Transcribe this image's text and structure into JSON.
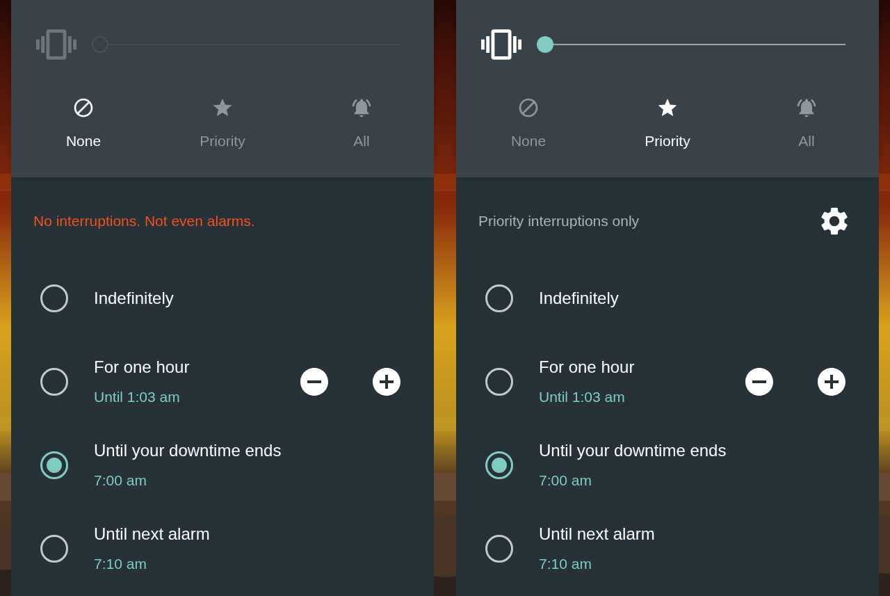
{
  "panels": [
    {
      "vibrate_slider": {
        "enabled": false,
        "level": 0
      },
      "modes": [
        {
          "label": "None",
          "kind": "none",
          "selected": true
        },
        {
          "label": "Priority",
          "kind": "priority",
          "selected": false
        },
        {
          "label": "All",
          "kind": "all",
          "selected": false
        }
      ],
      "status": {
        "text": "No interruptions. Not even alarms.",
        "kind": "warning"
      },
      "options": [
        {
          "title": "Indefinitely",
          "kind": "plain",
          "selected": false
        },
        {
          "title": "For one hour",
          "subtitle": "Until 1:03 am",
          "kind": "stepper",
          "selected": false
        },
        {
          "title": "Until your downtime ends",
          "subtitle": "7:00 am",
          "kind": "plain",
          "selected": true
        },
        {
          "title": "Until next alarm",
          "subtitle": "7:10 am",
          "kind": "plain",
          "selected": false
        }
      ]
    },
    {
      "vibrate_slider": {
        "enabled": true,
        "level": 0
      },
      "modes": [
        {
          "label": "None",
          "kind": "none",
          "selected": false
        },
        {
          "label": "Priority",
          "kind": "priority",
          "selected": true
        },
        {
          "label": "All",
          "kind": "all",
          "selected": false
        }
      ],
      "status": {
        "text": "Priority interruptions only",
        "kind": "info",
        "settings": true
      },
      "options": [
        {
          "title": "Indefinitely",
          "kind": "plain",
          "selected": false
        },
        {
          "title": "For one hour",
          "subtitle": "Until 1:03 am",
          "kind": "stepper",
          "selected": false
        },
        {
          "title": "Until your downtime ends",
          "subtitle": "7:00 am",
          "kind": "plain",
          "selected": true
        },
        {
          "title": "Until next alarm",
          "subtitle": "7:10 am",
          "kind": "plain",
          "selected": false
        }
      ]
    }
  ]
}
